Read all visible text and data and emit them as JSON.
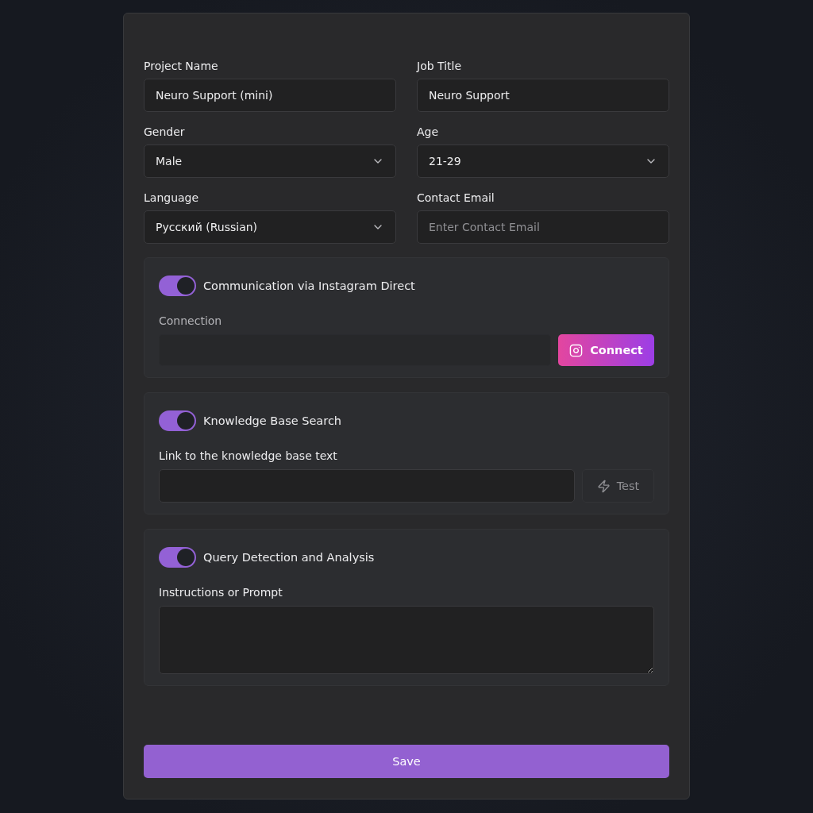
{
  "fields": [
    {
      "label": "Project Name",
      "kind": "input",
      "value": "Neuro Support (mini)"
    },
    {
      "label": "Job Title",
      "kind": "input",
      "value": "Neuro Support"
    },
    {
      "label": "Gender",
      "kind": "select",
      "value": "Male"
    },
    {
      "label": "Age",
      "kind": "select",
      "value": "21-29"
    },
    {
      "label": "Language",
      "kind": "select",
      "value": "Русский (Russian)"
    },
    {
      "label": "Contact Email",
      "kind": "input",
      "placeholder": "Enter Contact Email"
    }
  ],
  "sections": [
    {
      "kind": "connect",
      "title": "Communication via Instagram Direct",
      "on": true,
      "label": "Connection",
      "button": "Connect"
    },
    {
      "kind": "link",
      "title": "Knowledge Base Search",
      "on": true,
      "label": "Link to the knowledge base text",
      "button": "Test"
    },
    {
      "kind": "prompt",
      "title": "Query Detection and Analysis",
      "on": true,
      "label": "Instructions or Prompt"
    }
  ],
  "save_button": "Save"
}
